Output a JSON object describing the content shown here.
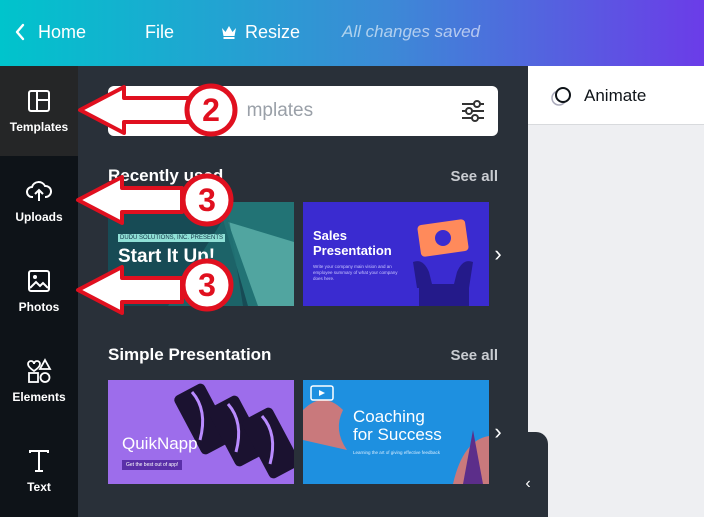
{
  "topbar": {
    "home_label": "Home",
    "file_label": "File",
    "resize_label": "Resize",
    "status": "All changes saved"
  },
  "rail": {
    "items": [
      {
        "label": "Templates",
        "icon": "layout-icon"
      },
      {
        "label": "Uploads",
        "icon": "cloud-upload-icon"
      },
      {
        "label": "Photos",
        "icon": "image-icon"
      },
      {
        "label": "Elements",
        "icon": "shapes-icon"
      },
      {
        "label": "Text",
        "icon": "text-icon"
      }
    ]
  },
  "search": {
    "placeholder_visible": "e",
    "placeholder_visible_2": "mplates"
  },
  "sections": [
    {
      "title": "Recently used",
      "see_all": "See all"
    },
    {
      "title": "Simple Presentation",
      "see_all": "See all"
    }
  ],
  "thumbnails": {
    "t1": {
      "eyebrow": "DUDU SOLUTIONS, INC. PRESENTS",
      "title": "Start It Up!"
    },
    "t2": {
      "title_line1": "Sales",
      "title_line2": "Presentation",
      "body": "Write your company main vision and an employee summary of what your company does here."
    },
    "t3": {
      "title": "QuikNapp",
      "tag": "Get the best out of app!"
    },
    "t4": {
      "title_line1": "Coaching",
      "title_line2": "for Success",
      "body": "Learning the art of giving effective feedback"
    }
  },
  "canvas": {
    "animate_label": "Animate"
  },
  "annotations": [
    {
      "number": "2"
    },
    {
      "number": "3"
    },
    {
      "number": "3"
    }
  ],
  "colors": {
    "accent_teal": "#00c4cc",
    "accent_purple": "#6b3ce8",
    "annotation_red": "#e0101f"
  }
}
